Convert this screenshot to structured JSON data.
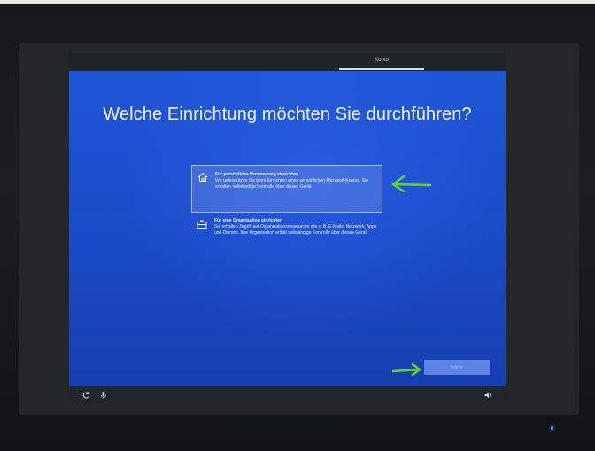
{
  "header": {
    "tab_label": "Konto"
  },
  "main": {
    "heading": "Welche Einrichtung möchten Sie durchführen?",
    "options": [
      {
        "title": "Für persönliche Verwendung einrichten",
        "description": "Wir unterstützen Sie beim Einrichten eines persönlichen Microsoft-Kontos. Sie erhalten vollständige Kontrolle über dieses Gerät.",
        "icon": "home-icon",
        "selected": true
      },
      {
        "title": "Für eine Organisation einrichten",
        "description": "Sie erhalten Zugriff auf Organisationsressourcen wie z. B. E-Mails, Netzwerk, Apps und Dienste. Ihre Organisation erhält vollständige Kontrolle über dieses Gerät.",
        "icon": "briefcase-icon",
        "selected": false
      }
    ],
    "next_label": "Weiter"
  },
  "bottom_bar": {
    "icons": [
      "ease-of-access-icon",
      "microphone-icon",
      "volume-icon"
    ]
  },
  "colors": {
    "screen_blue": "#1c4dcb",
    "annotation_green": "#5fd42a",
    "next_button": "#5b84e6"
  }
}
